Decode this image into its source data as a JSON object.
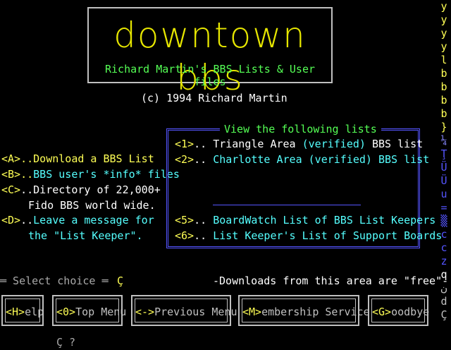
{
  "logo": {
    "title": "downtown bbs",
    "subtitle": "Richard Martin's BBS Lists & User files"
  },
  "copyright": "(c) 1994 Richard Martin",
  "menu": [
    {
      "key": "<A>",
      "dots": "..",
      "text": "Download a BBS List"
    },
    {
      "key": "<B>",
      "dots": "..",
      "text": "BBS user's *info* files"
    },
    {
      "key": "<C>",
      "dots": "..",
      "text": "Directory of 22,000+",
      "text2": "Fido BBS world wide."
    },
    {
      "key": "<D>",
      "dots": "..",
      "text": "Leave a message for",
      "text2": "the \"List Keeper\"."
    }
  ],
  "lists": {
    "title": "View the following lists",
    "items": [
      {
        "key": "<1>",
        "dots": "..",
        "a": "Triangle Area",
        "b": "(verified)",
        "c": "BBS list"
      },
      {
        "key": "<2>",
        "dots": "..",
        "a": "Charlotte Area (verified) BBS list"
      },
      {
        "key": "<5>",
        "dots": "..",
        "a": "BoardWatch List of BBS List Keepers"
      },
      {
        "key": "<6>",
        "dots": "..",
        "a": "List Keeper's List of Support Boards"
      }
    ]
  },
  "prompt": {
    "label": "═ Select choice ═",
    "cursor": "Ç"
  },
  "downloads_note": "-Downloads from this area are \"free\"-",
  "buttons": [
    {
      "key": "<H>",
      "rest": "elp"
    },
    {
      "key": "<0>",
      "rest": "Top Menu"
    },
    {
      "key": "<->",
      "rest": "Previous Menu"
    },
    {
      "key": "<M>",
      "rest": "embership Service"
    },
    {
      "key": "<G>",
      "rest": "oodbye"
    }
  ],
  "bottom_prompt": "Ç ?",
  "sidebar": [
    "y",
    "y",
    "y",
    "y",
    "l",
    "b",
    "b",
    "b",
    "b",
    "}",
    "¼",
    "Ţ",
    "Ü",
    "Ü",
    "u",
    "=",
    "▒",
    "c",
    "c",
    "z",
    "q",
    "ن",
    "d",
    "Ç"
  ]
}
